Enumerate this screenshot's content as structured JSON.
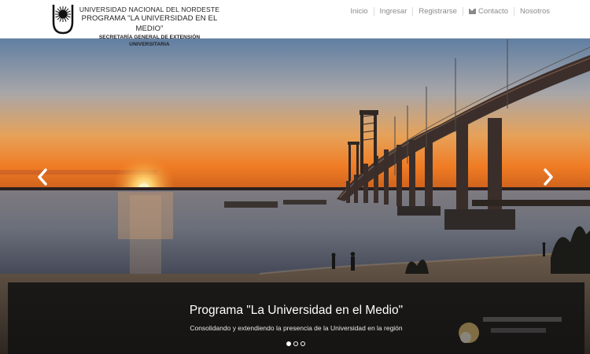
{
  "header": {
    "brand": {
      "line1": "UNIVERSIDAD NACIONAL DEL NORDESTE",
      "line2": "PROGRAMA \"LA UNIVERSIDAD EN EL MEDIO\"",
      "line3": "SECRETARÍA GENERAL DE EXTENSIÓN UNIVERSITARIA"
    },
    "nav": [
      {
        "label": "Inicio"
      },
      {
        "label": "Ingresar"
      },
      {
        "label": "Registrarse"
      },
      {
        "label": "Contacto",
        "icon": "envelope-icon"
      },
      {
        "label": "Nosotros"
      }
    ]
  },
  "carousel": {
    "caption_title": "Programa \"La Universidad en el Medio\"",
    "caption_subtitle": "Consolidando y extendiendo la presencia de la Universidad en la región",
    "slides_count": 3,
    "active_slide": 1,
    "prev_icon": "chevron-left-icon",
    "next_icon": "chevron-right-icon"
  },
  "colors": {
    "sky_top": "#6f8fb4",
    "sky_horizon": "#f08a2c",
    "sun": "#fff2b0",
    "bridge": "#3a2e2a",
    "caption_bg": "#121212"
  }
}
